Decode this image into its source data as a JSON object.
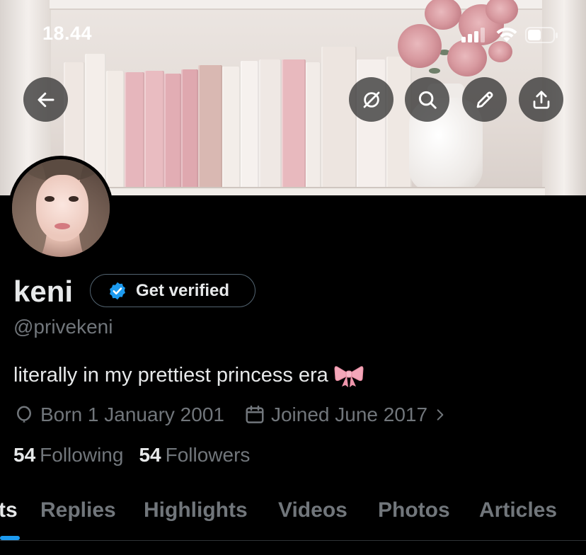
{
  "status_bar": {
    "time": "18.44"
  },
  "profile": {
    "name": "keni",
    "verify_label": "Get verified",
    "handle": "@privekeni",
    "bio": "literally in my prettiest princess era",
    "birth": "Born 1 January 2001",
    "joined": "Joined June 2017",
    "following_count": "54",
    "following_label": "Following",
    "followers_count": "54",
    "followers_label": "Followers"
  },
  "tabs": [
    {
      "label": "ts"
    },
    {
      "label": "Replies"
    },
    {
      "label": "Highlights"
    },
    {
      "label": "Videos"
    },
    {
      "label": "Photos"
    },
    {
      "label": "Articles"
    }
  ],
  "icons": {
    "back": "arrow-left-icon",
    "grok": "grok-icon",
    "search": "search-icon",
    "edit": "pencil-icon",
    "share": "share-icon",
    "birthday": "balloon-icon",
    "calendar": "calendar-icon",
    "verified": "verified-badge-icon"
  },
  "colors": {
    "background": "#000000",
    "text_primary": "#e7e9ea",
    "text_secondary": "#71767b",
    "accent": "#1d9bf0",
    "border": "#536471"
  }
}
